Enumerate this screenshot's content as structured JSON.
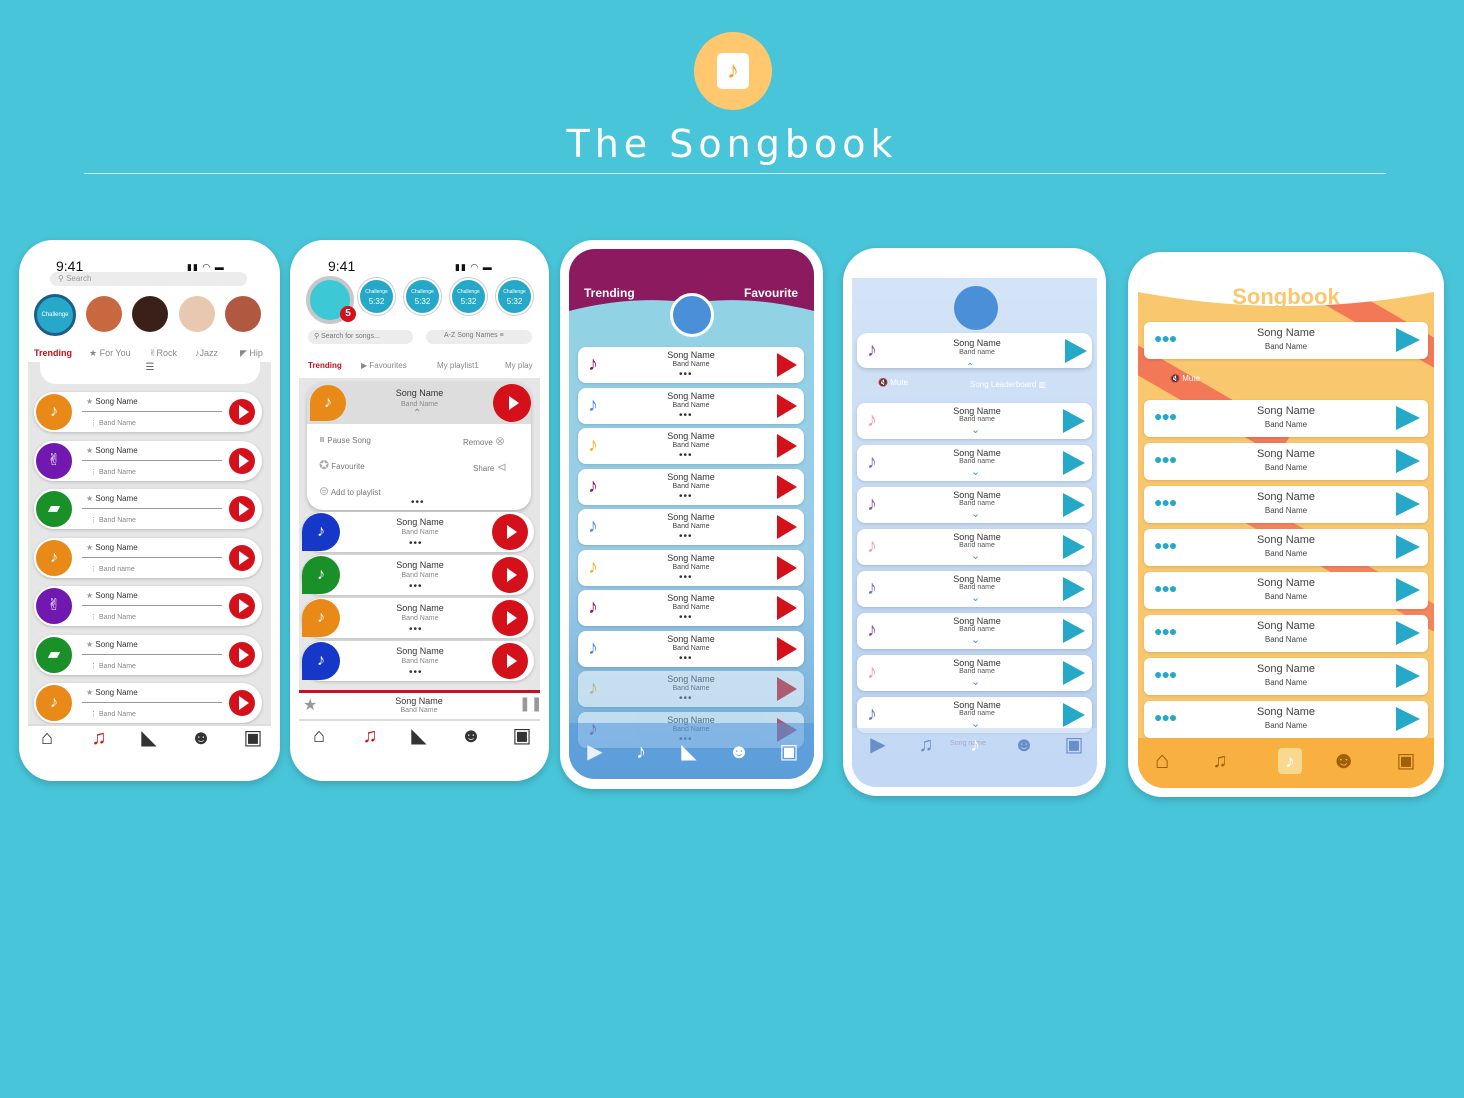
{
  "header": {
    "title": "The Songbook",
    "logo_icon": "music-note-book-icon"
  },
  "colors": {
    "background": "#48c5d9",
    "play_red": "#d4111a",
    "teal": "#26a9c8",
    "maroon": "#8b1a5e",
    "orange": "#f9c76d"
  },
  "s1": {
    "time": "9:41",
    "search_placeholder": "Search",
    "challenge": "Challenge",
    "tabs": [
      "Trending",
      "For You",
      "Rock",
      "Jazz",
      "Hip"
    ],
    "rows": [
      {
        "song": "Song Name",
        "band": "Band Name",
        "icon": "saxophone-icon",
        "color": "#e98a18"
      },
      {
        "song": "Song Name",
        "band": "Band Name",
        "icon": "rock-hand-icon",
        "color": "#7018b0"
      },
      {
        "song": "Song Name",
        "band": "Band Name",
        "icon": "piano-icon",
        "color": "#1a9028"
      },
      {
        "song": "Song Name",
        "band": "Band name",
        "icon": "saxophone-icon",
        "color": "#e98a18"
      },
      {
        "song": "Song Name",
        "band": "Band Name",
        "icon": "rock-hand-icon",
        "color": "#7018b0"
      },
      {
        "song": "Song Name",
        "band": "Band Name",
        "icon": "piano-icon",
        "color": "#1a9028"
      },
      {
        "song": "Song Name",
        "band": "Band Name",
        "icon": "saxophone-icon",
        "color": "#e98a18"
      }
    ]
  },
  "s2": {
    "time": "9:41",
    "badge": "5",
    "challenges": [
      {
        "label": "Challenge",
        "time": "5:32"
      },
      {
        "label": "Challenge",
        "time": "5:32"
      },
      {
        "label": "Challenge",
        "time": "5:32"
      },
      {
        "label": "Challenge",
        "time": "5:32"
      }
    ],
    "search_placeholder": "Search for songs...",
    "sort": "A-Z Song Names",
    "tabs": [
      "Trending",
      "Favourites",
      "My playlist1",
      "My play"
    ],
    "expanded": {
      "song": "Song Name",
      "band": "Band Name",
      "pause": "Pause Song",
      "remove": "Remove",
      "favourite": "Favourite",
      "share": "Share",
      "add": "Add to playlist"
    },
    "rows": [
      {
        "song": "Song Name",
        "band": "Band Name",
        "color": "#1638c8"
      },
      {
        "song": "Song Name",
        "band": "Band Name",
        "color": "#1a9028"
      },
      {
        "song": "Song Name",
        "band": "Band Name",
        "color": "#e98a18"
      },
      {
        "song": "Song Name",
        "band": "Band Name",
        "color": "#1638c8"
      }
    ],
    "player": {
      "song": "Song Name",
      "band": "Band Name"
    }
  },
  "s3": {
    "tab_left": "Trending",
    "tab_right": "Favourite",
    "rows": [
      {
        "song": "Song Name",
        "band": "Band Name",
        "color": "#8b1a5e"
      },
      {
        "song": "Song Name",
        "band": "Band Name",
        "color": "#4a90d9"
      },
      {
        "song": "Song Name",
        "band": "Band Name",
        "color": "#f0b430"
      },
      {
        "song": "Song Name",
        "band": "Band Name",
        "color": "#8b1a5e"
      },
      {
        "song": "Song Name",
        "band": "Band Name",
        "color": "#4a90d9"
      },
      {
        "song": "Song Name",
        "band": "Band Name",
        "color": "#f0b430"
      },
      {
        "song": "Song Name",
        "band": "Band Name",
        "color": "#8b1a5e"
      },
      {
        "song": "Song Name",
        "band": "Band Name",
        "color": "#4a90d9"
      },
      {
        "song": "Song Name",
        "band": "Band Name",
        "color": "#f0b430"
      },
      {
        "song": "Song Name",
        "band": "Band Name",
        "color": "#8b1a5e"
      }
    ]
  },
  "s4": {
    "top": {
      "song": "Song Name",
      "band": "Band name"
    },
    "mute": "Mute",
    "leaderboard": "Song Leaderboard",
    "rows": [
      {
        "song": "Song Name",
        "band": "Band name",
        "color": "#f4a0a0"
      },
      {
        "song": "Song Name",
        "band": "Band name",
        "color": "#6a7fc0"
      },
      {
        "song": "Song Name",
        "band": "Band name",
        "color": "#8a5aa8"
      },
      {
        "song": "Song Name",
        "band": "Band name",
        "color": "#f4a0a0"
      },
      {
        "song": "Song Name",
        "band": "Band name",
        "color": "#6a7fc0"
      },
      {
        "song": "Song Name",
        "band": "Band name",
        "color": "#8a5aa8"
      },
      {
        "song": "Song Name",
        "band": "Band name",
        "color": "#f4a0a0"
      },
      {
        "song": "Song Name",
        "band": "Band name",
        "color": "#6a7fc0"
      }
    ],
    "nav_partial": "Song name"
  },
  "s5": {
    "title": "Songbook",
    "mute": "Mute",
    "rows": [
      {
        "song": "Song Name",
        "band": "Band Name"
      },
      {
        "song": "Song Name",
        "band": "Band Name"
      },
      {
        "song": "Song Name",
        "band": "Band Name"
      },
      {
        "song": "Song Name",
        "band": "Band Name"
      },
      {
        "song": "Song Name",
        "band": "Band Name"
      },
      {
        "song": "Song Name",
        "band": "Band Name"
      },
      {
        "song": "Song Name",
        "band": "Band Name"
      },
      {
        "song": "Song Name",
        "band": "Band Name"
      },
      {
        "song": "Song Name",
        "band": "Band Name"
      }
    ]
  }
}
